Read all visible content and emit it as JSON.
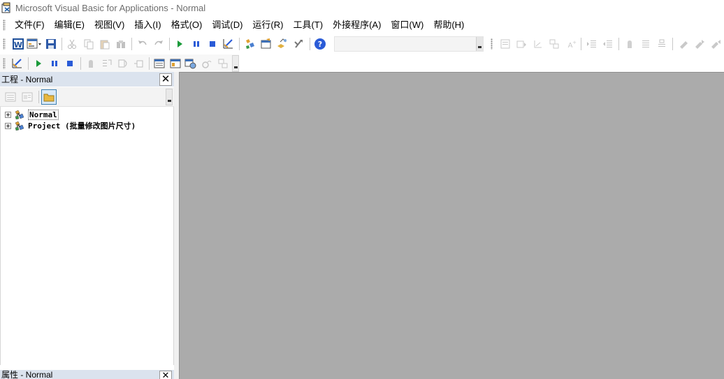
{
  "window": {
    "title": "Microsoft Visual Basic for Applications - Normal"
  },
  "menu": [
    "文件(F)",
    "编辑(E)",
    "视图(V)",
    "插入(I)",
    "格式(O)",
    "调试(D)",
    "运行(R)",
    "工具(T)",
    "外接程序(A)",
    "窗口(W)",
    "帮助(H)"
  ],
  "toolbar_standard": {
    "buttons": [
      "view-word-icon",
      "insert-userform-icon",
      "save-icon",
      "cut-icon",
      "copy-icon",
      "paste-icon",
      "find-icon",
      "undo-icon",
      "redo-icon",
      "run-icon",
      "break-icon",
      "reset-icon",
      "design-mode-icon",
      "project-explorer-icon",
      "properties-window-icon",
      "object-browser-icon",
      "toolbox-icon",
      "help-icon"
    ],
    "location_combo_value": "",
    "edit_buttons": [
      "list-properties-icon",
      "list-constants-icon",
      "quick-info-icon",
      "parameter-info-icon",
      "complete-word-icon",
      "indent-icon",
      "outdent-icon",
      "toggle-breakpoint-icon",
      "comment-block-icon",
      "uncomment-block-icon",
      "toggle-bookmark-icon",
      "next-bookmark-icon",
      "previous-bookmark-icon"
    ]
  },
  "toolbar_debug": {
    "buttons": [
      "design-mode-icon",
      "run-icon",
      "break-icon",
      "reset-icon",
      "toggle-breakpoint-icon",
      "step-into-icon",
      "step-over-icon",
      "step-out-icon",
      "locals-window-icon",
      "immediate-window-icon",
      "watch-window-icon",
      "quick-watch-icon",
      "call-stack-icon"
    ]
  },
  "project_pane": {
    "title": "工程 - Normal",
    "close_glyph": "✕",
    "tree": [
      {
        "label": "Normal",
        "selected": true
      },
      {
        "label": "Project (批量修改图片尺寸)",
        "selected": false
      }
    ]
  },
  "properties_pane": {
    "title": "属性 - Normal",
    "close_glyph": "✕"
  },
  "colors": {
    "workspace": "#ababab",
    "pane_header": "#dbe3ee",
    "run_green": "#1a9a3a",
    "stop_blue": "#2a5bd7"
  }
}
